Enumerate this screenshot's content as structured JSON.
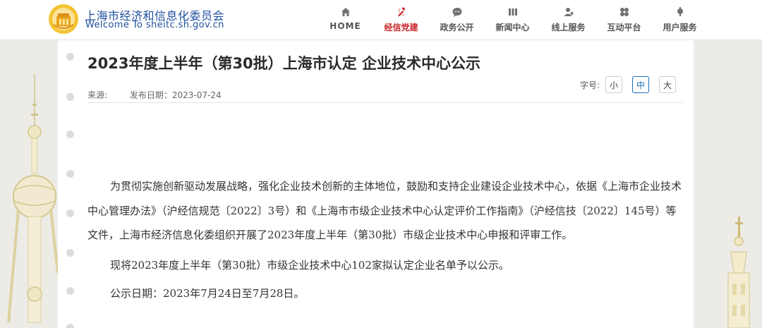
{
  "header": {
    "org_name_cn": "上海市经济和信息化委员会",
    "org_name_en": "Welcome To sheitc.sh.gov.cn",
    "brand_color": "#1d4e9e",
    "active_color": "#c8262b"
  },
  "nav": {
    "items": [
      {
        "label": "HOME",
        "icon": "home-icon"
      },
      {
        "label": "经信党建",
        "icon": "party-emblem-icon",
        "active": true
      },
      {
        "label": "政务公开",
        "icon": "chat-bubble-icon"
      },
      {
        "label": "新闻中心",
        "icon": "news-icon"
      },
      {
        "label": "线上服务",
        "icon": "person-service-icon"
      },
      {
        "label": "互动平台",
        "icon": "interaction-icon"
      },
      {
        "label": "用户服务",
        "icon": "user-service-icon"
      }
    ]
  },
  "article": {
    "title": "2023年度上半年（第30批）上海市认定 企业技术中心公示",
    "source_label": "来源:",
    "date_label": "发布日期：2023-07-24",
    "font_size_label": "字号:",
    "font_size_options": [
      "小",
      "中",
      "大"
    ],
    "font_size_selected": "中",
    "paragraphs": [
      "为贯彻实施创新驱动发展战略，强化企业技术创新的主体地位，鼓励和支持企业建设企业技术中心，依据《上海市企业技术中心管理办法》（沪经信规范〔2022〕3号）和《上海市市级企业技术中心认定评价工作指南》（沪经信技〔2022〕145号）等文件，上海市经济信息化委组织开展了2023年度上半年（第30批）市级企业技术中心申报和评审工作。",
      "现将2023年度上半年（第30批）市级企业技术中心102家拟认定企业名单予以公示。",
      "公示日期：2023年7月24日至7月28日。"
    ]
  }
}
